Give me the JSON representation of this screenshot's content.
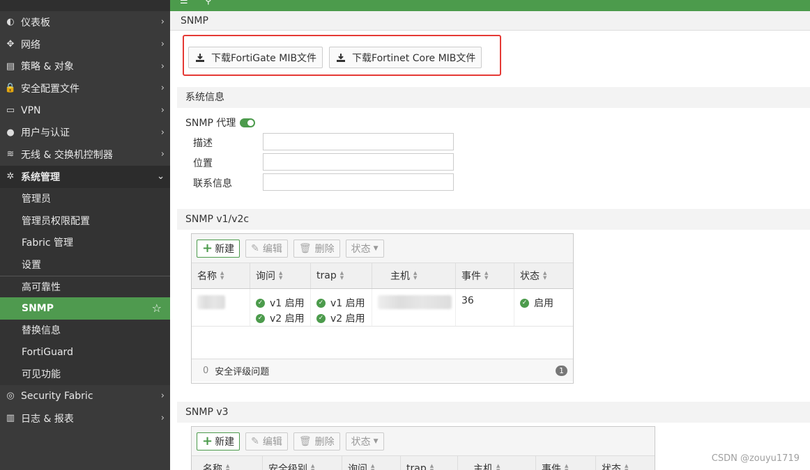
{
  "sidebar": {
    "items": [
      {
        "label": "仪表板",
        "icon": "dashboard-icon",
        "glyph": "◐"
      },
      {
        "label": "网络",
        "icon": "network-icon",
        "glyph": "✥"
      },
      {
        "label": "策略 & 对象",
        "icon": "policy-icon",
        "glyph": "▤"
      },
      {
        "label": "安全配置文件",
        "icon": "lock-icon",
        "glyph": "🔒"
      },
      {
        "label": "VPN",
        "icon": "monitor-icon",
        "glyph": "▭"
      },
      {
        "label": "用户与认证",
        "icon": "user-icon",
        "glyph": "●"
      },
      {
        "label": "无线 & 交换机控制器",
        "icon": "wifi-icon",
        "glyph": "≋"
      }
    ],
    "expanded": {
      "label": "系统管理",
      "icon": "gear-icon",
      "glyph": "✲"
    },
    "subitems": [
      {
        "label": "管理员"
      },
      {
        "label": "管理员权限配置"
      },
      {
        "label": "Fabric 管理"
      },
      {
        "label": "设置"
      },
      {
        "label": "高可靠性"
      },
      {
        "label": "SNMP"
      },
      {
        "label": "替换信息"
      },
      {
        "label": "FortiGuard"
      },
      {
        "label": "可见功能"
      }
    ],
    "bottom_items": [
      {
        "label": "Security Fabric",
        "icon": "fabric-icon",
        "glyph": "◎"
      },
      {
        "label": "日志 & 报表",
        "icon": "chart-icon",
        "glyph": "▥"
      }
    ]
  },
  "page": {
    "title": "SNMP"
  },
  "downloads": {
    "fortigate_mib": "下载FortiGate MIB文件",
    "core_mib": "下载Fortinet Core MIB文件"
  },
  "system_info": {
    "section_title": "系统信息",
    "agent_label": "SNMP 代理",
    "agent_enabled": true,
    "description_label": "描述",
    "location_label": "位置",
    "contact_label": "联系信息"
  },
  "v1v2c": {
    "section_title": "SNMP v1/v2c",
    "toolbar": {
      "new": "新建",
      "edit": "编辑",
      "delete": "删除",
      "status": "状态"
    },
    "columns": [
      "名称",
      "询问",
      "trap",
      "主机",
      "事件",
      "状态"
    ],
    "row": {
      "query": [
        "v1 启用",
        "v2 启用"
      ],
      "trap": [
        "v1 启用",
        "v2 启用"
      ],
      "events": "36",
      "status": "启用"
    },
    "footer": {
      "zero": "0",
      "label": "安全评级问题",
      "badge": "1"
    }
  },
  "v3": {
    "section_title": "SNMP v3",
    "toolbar": {
      "new": "新建",
      "edit": "编辑",
      "delete": "删除",
      "status": "状态"
    },
    "columns": [
      "名称",
      "安全级别",
      "询问",
      "trap",
      "主机",
      "事件",
      "状态"
    ]
  },
  "watermark": "CSDN @zouyu1719"
}
